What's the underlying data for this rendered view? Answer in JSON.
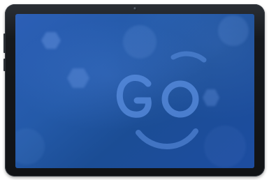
{
  "device": {
    "type": "tablet",
    "frame_color": "#16191d",
    "screen_color": "#245aa9"
  },
  "wallpaper": {
    "logo_text": "GO",
    "logo_color": "#5b8fe0",
    "icons": {
      "camera": "front-camera-icon"
    }
  }
}
